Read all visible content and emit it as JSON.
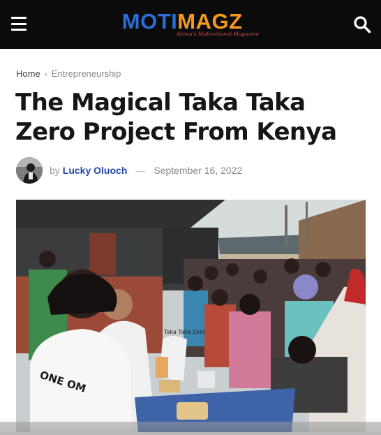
{
  "header": {
    "brand_part1": "MOTI",
    "brand_part2": "MAGZ",
    "tagline": "Africa's Motivational Magazine",
    "icons": {
      "menu": "hamburger-menu-icon",
      "search": "search-icon"
    }
  },
  "breadcrumb": {
    "home": "Home",
    "separator": "›",
    "category": "Entrepreneurship"
  },
  "article": {
    "title": "The Magical Taka Taka Zero Project From Kenya",
    "by": "by",
    "author": "Lucky Oluoch",
    "dash": "—",
    "date": "September 16, 2022"
  },
  "hero_image": {
    "apron_text": "Taka Taka Zero",
    "shirt_text": "ONE OM"
  },
  "colors": {
    "topbar": "#0b0b0b",
    "brand_blue": "#2a6fd6",
    "brand_orange": "#f39a1e",
    "author_link": "#2348a8"
  }
}
